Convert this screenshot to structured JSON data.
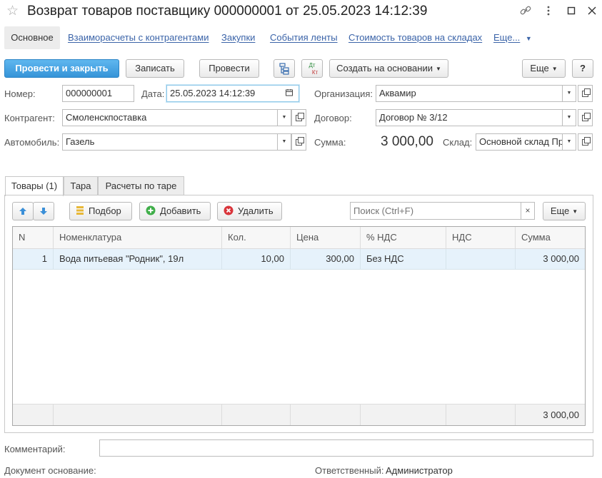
{
  "window": {
    "title": "Возврат товаров поставщику 000000001 от 25.05.2023 14:12:39"
  },
  "nav": {
    "active": "Основное",
    "links": [
      "Взаиморасчеты с контрагентами",
      "Закупки",
      "События ленты",
      "Стоимость товаров на складах",
      "Еще..."
    ]
  },
  "toolbar": {
    "post_close": "Провести и закрыть",
    "save": "Записать",
    "post": "Провести",
    "dtkt_top": "Дт",
    "dtkt_bottom": "Кт",
    "create_based": "Создать на основании",
    "more": "Еще",
    "help": "?"
  },
  "form": {
    "number_label": "Номер:",
    "number": "000000001",
    "date_label": "Дата:",
    "date": "25.05.2023 14:12:39",
    "org_label": "Организация:",
    "org": "Аквамир",
    "contractor_label": "Контрагент:",
    "contractor": "Смоленскпоставка",
    "contract_label": "Договор:",
    "contract": "Договор № 3/12",
    "car_label": "Автомобиль:",
    "car": "Газель",
    "sum_label": "Сумма:",
    "sum": "3 000,00",
    "warehouse_label": "Склад:",
    "warehouse": "Основной склад Пр"
  },
  "tabs": [
    "Товары (1)",
    "Тара",
    "Расчеты по таре"
  ],
  "table_toolbar": {
    "pick": "Подбор",
    "add": "Добавить",
    "delete": "Удалить",
    "search_placeholder": "Поиск (Ctrl+F)",
    "more": "Еще"
  },
  "table": {
    "columns": [
      "N",
      "Номенклатура",
      "Кол.",
      "Цена",
      "% НДС",
      "НДС",
      "Сумма"
    ],
    "rows": [
      {
        "n": "1",
        "item": "Вода питьевая \"Родник\", 19л",
        "qty": "10,00",
        "price": "300,00",
        "vat_rate": "Без НДС",
        "vat": "",
        "sum": "3 000,00"
      }
    ],
    "total_sum": "3 000,00"
  },
  "footer": {
    "comment_label": "Комментарий:",
    "base_doc_label": "Документ основание:",
    "responsible_label": "Ответственный:",
    "responsible": "Администратор"
  },
  "icons": [
    "star-icon",
    "link-icon",
    "more-vert-icon",
    "minimize-icon",
    "close-icon",
    "structure-icon",
    "arrow-up-icon",
    "arrow-down-icon",
    "pick-icon",
    "add-icon",
    "delete-icon",
    "calendar-icon",
    "chevron-down-icon",
    "open-icon"
  ],
  "colors": {
    "accent": "#3694d8",
    "link": "#3a63a8",
    "selected_row": "#e6f2fb",
    "add_green": "#3fae49",
    "delete_red": "#d9343a"
  }
}
